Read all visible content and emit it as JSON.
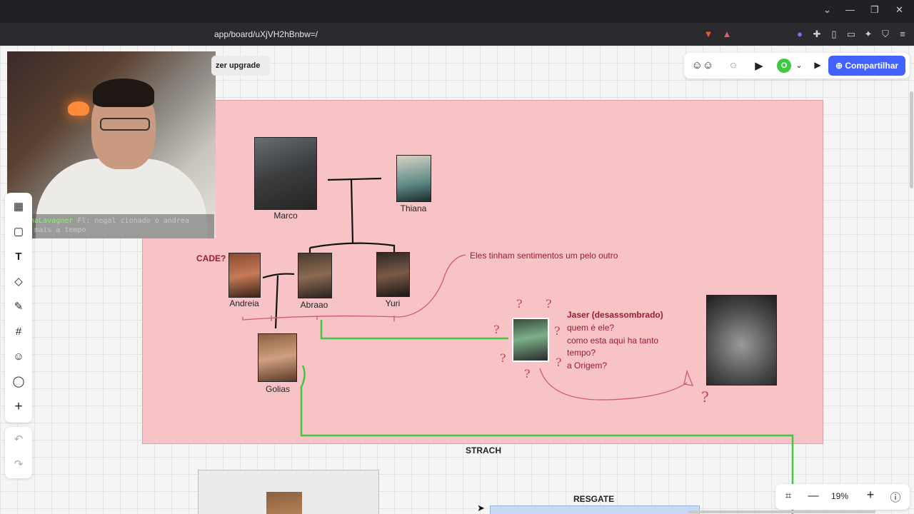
{
  "browser": {
    "url": "app/board/uXjVH2hBnbw=/",
    "window_controls": [
      "⌄",
      "—",
      "❐",
      "✕"
    ]
  },
  "stream": {
    "chat_user": "MarinaLavagner",
    "chat_text": "Fl: negal cionado o andrea esta mais a tempo"
  },
  "toolbar": {
    "upgrade_label": "zer upgrade",
    "avatar_initial": "O",
    "share_label": "Compartilhar",
    "zoom_level": "19%"
  },
  "board": {
    "characters": [
      {
        "id": "marco",
        "name": "Marco"
      },
      {
        "id": "thiana",
        "name": "Thiana"
      },
      {
        "id": "andreia",
        "name": "Andreia"
      },
      {
        "id": "abraao",
        "name": "Abraao"
      },
      {
        "id": "yuri",
        "name": "Yuri"
      },
      {
        "id": "golias",
        "name": "Golias"
      }
    ],
    "cade_note": "CADE?",
    "feelings_note": "Eles tinham sentimentos um pelo outro",
    "jaser": {
      "title": "Jaser (desassombrado)",
      "lines": [
        "quem é ele?",
        "como esta aqui ha tanto",
        "tempo?",
        "a Origem?"
      ]
    },
    "sections": {
      "strach": "STRACH",
      "resgate": "RESGATE"
    }
  },
  "colors": {
    "frame_pink": "#f7c3c7",
    "accent_blue": "#4262ff",
    "note_red": "#9b1c2c",
    "line_green": "#3ec93e"
  }
}
